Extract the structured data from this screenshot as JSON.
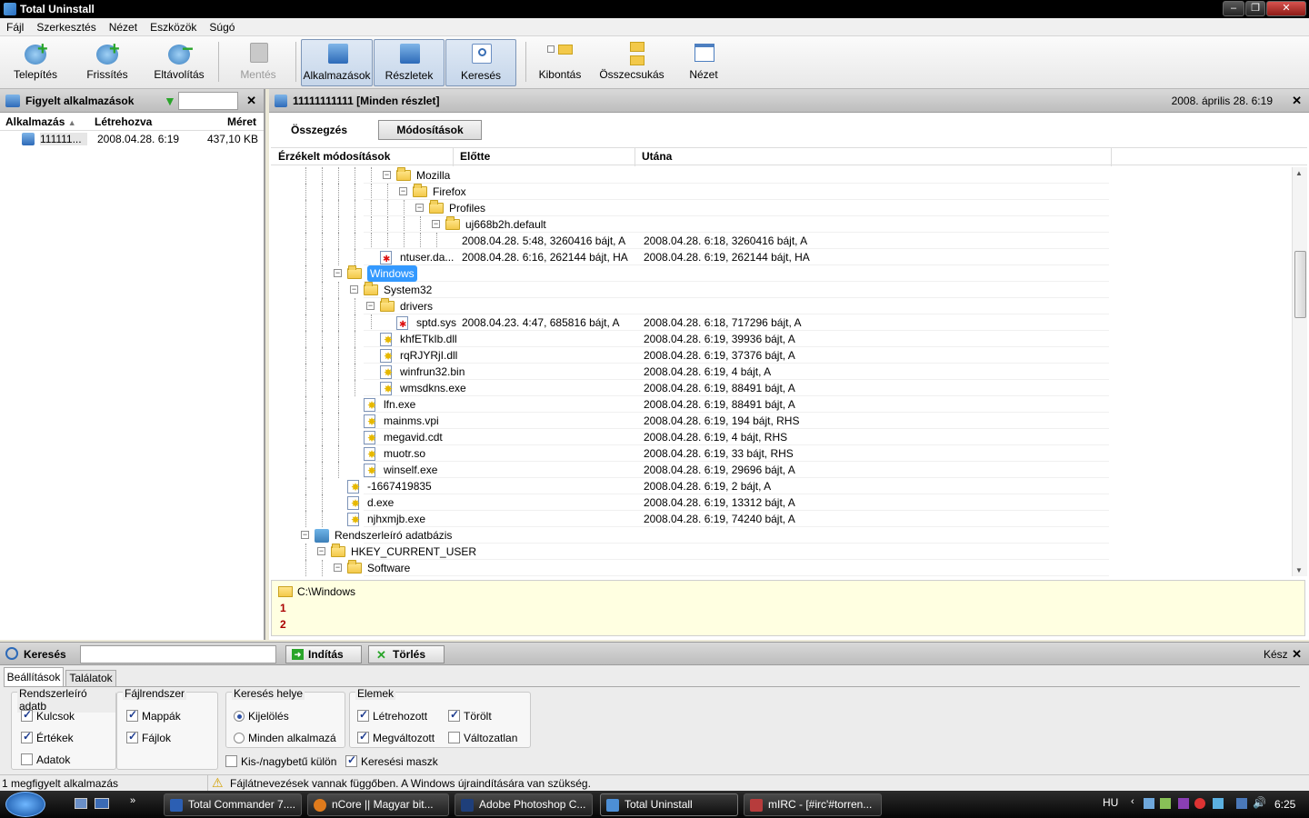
{
  "window": {
    "title": "Total Uninstall"
  },
  "menu": [
    "Fájl",
    "Szerkesztés",
    "Nézet",
    "Eszközök",
    "Súgó"
  ],
  "toolbar": {
    "install": "Telepítés",
    "refresh": "Frissítés",
    "remove": "Eltávolítás",
    "save": "Mentés",
    "apps": "Alkalmazások",
    "details": "Részletek",
    "search": "Keresés",
    "expand": "Kibontás",
    "collapse": "Összecsukás",
    "view": "Nézet"
  },
  "left": {
    "title": "Figyelt alkalmazások",
    "filter_value": "",
    "columns": [
      "Alkalmazás",
      "Létrehozva",
      "Méret"
    ],
    "rows": [
      {
        "name": "111111...",
        "created": "2008.04.28. 6:19",
        "size": "437,10 KB"
      }
    ]
  },
  "right": {
    "title": "11111111111 [Minden részlet]",
    "date": "2008. április 28. 6:19",
    "tabs": [
      "Összegzés",
      "Módosítások"
    ],
    "columns": [
      "Érzékelt módosítások",
      "Előtte",
      "Utána"
    ]
  },
  "tree": [
    {
      "label": "Mozilla",
      "kind": "folder",
      "level": 7
    },
    {
      "label": "Firefox",
      "kind": "folder",
      "level": 8
    },
    {
      "label": "Profiles",
      "kind": "folder",
      "level": 9
    },
    {
      "label": "uj668b2h.default",
      "kind": "folder",
      "level": 10
    },
    {
      "label": "",
      "kind": "none",
      "level": 11,
      "before": "2008.04.28. 5:48, 3260416 bájt, A",
      "after": "2008.04.28. 6:18, 3260416 bájt, A"
    },
    {
      "label": "ntuser.da...",
      "kind": "mod",
      "level": 6,
      "before": "2008.04.28. 6:16, 262144 bájt, HA",
      "after": "2008.04.28. 6:19, 262144 bájt, HA"
    },
    {
      "label": "Windows",
      "kind": "folder",
      "level": 4,
      "selected": true
    },
    {
      "label": "System32",
      "kind": "folder",
      "level": 5
    },
    {
      "label": "drivers",
      "kind": "folder",
      "level": 6
    },
    {
      "label": "sptd.sys",
      "kind": "mod",
      "level": 7,
      "before": "2008.04.23. 4:47, 685816 bájt, A",
      "after": "2008.04.28. 6:18, 717296 bájt, A"
    },
    {
      "label": "khfETkIb.dll",
      "kind": "new",
      "level": 6,
      "after": "2008.04.28. 6:19, 39936 bájt, A"
    },
    {
      "label": "rqRJYRjI.dll",
      "kind": "new",
      "level": 6,
      "after": "2008.04.28. 6:19, 37376 bájt, A"
    },
    {
      "label": "winfrun32.bin",
      "kind": "new",
      "level": 6,
      "after": "2008.04.28. 6:19, 4 bájt, A"
    },
    {
      "label": "wmsdkns.exe",
      "kind": "new",
      "level": 6,
      "after": "2008.04.28. 6:19, 88491 bájt, A"
    },
    {
      "label": "lfn.exe",
      "kind": "new",
      "level": 5,
      "after": "2008.04.28. 6:19, 88491 bájt, A"
    },
    {
      "label": "mainms.vpi",
      "kind": "new",
      "level": 5,
      "after": "2008.04.28. 6:19, 194 bájt, RHS"
    },
    {
      "label": "megavid.cdt",
      "kind": "new",
      "level": 5,
      "after": "2008.04.28. 6:19, 4 bájt, RHS"
    },
    {
      "label": "muotr.so",
      "kind": "new",
      "level": 5,
      "after": "2008.04.28. 6:19, 33 bájt, RHS"
    },
    {
      "label": "winself.exe",
      "kind": "new",
      "level": 5,
      "after": "2008.04.28. 6:19, 29696 bájt, A"
    },
    {
      "label": "-1667419835",
      "kind": "new",
      "level": 4,
      "after": "2008.04.28. 6:19, 2 bájt, A"
    },
    {
      "label": "d.exe",
      "kind": "new",
      "level": 4,
      "after": "2008.04.28. 6:19, 13312 bájt, A"
    },
    {
      "label": "njhxmjb.exe",
      "kind": "new",
      "level": 4,
      "after": "2008.04.28. 6:19, 74240 bájt, A"
    },
    {
      "label": "Rendszerleíró adatbázis",
      "kind": "reg",
      "level": 2
    },
    {
      "label": "HKEY_CURRENT_USER",
      "kind": "folder",
      "level": 3
    },
    {
      "label": "Software",
      "kind": "folder",
      "level": 4
    }
  ],
  "pathpanel": {
    "path": "C:\\Windows",
    "line1": "1",
    "line2": "2"
  },
  "search": {
    "title": "Keresés",
    "input": "",
    "start": "Indítás",
    "clear": "Törlés",
    "status": "Kész",
    "tabs": [
      "Beállítások",
      "Találatok"
    ],
    "groups": {
      "registry": {
        "title": "Rendszerleíró adatb",
        "keys": "Kulcsok",
        "values": "Értékek",
        "data": "Adatok"
      },
      "filesystem": {
        "title": "Fájlrendszer",
        "folders": "Mappák",
        "files": "Fájlok"
      },
      "location": {
        "title": "Keresés helye",
        "selection": "Kijelölés",
        "all": "Minden alkalmazá"
      },
      "items": {
        "title": "Elemek",
        "created": "Létrehozott",
        "deleted": "Törölt",
        "changed": "Megváltozott",
        "unchanged": "Változatlan"
      }
    },
    "case": "Kis-/nagybetű külön",
    "mask": "Keresési maszk"
  },
  "status": {
    "left": "1 megfigyelt alkalmazás",
    "warning": "Fájlátnevezések vannak függőben. A Windows újraindítására van szükség."
  },
  "taskbar": {
    "tasks": [
      "Total Commander 7....",
      "nCore || Magyar bit...",
      "Adobe Photoshop C...",
      "Total Uninstall",
      "mIRC - [#irc'#torren..."
    ],
    "lang": "HU",
    "clock": "6:25"
  }
}
